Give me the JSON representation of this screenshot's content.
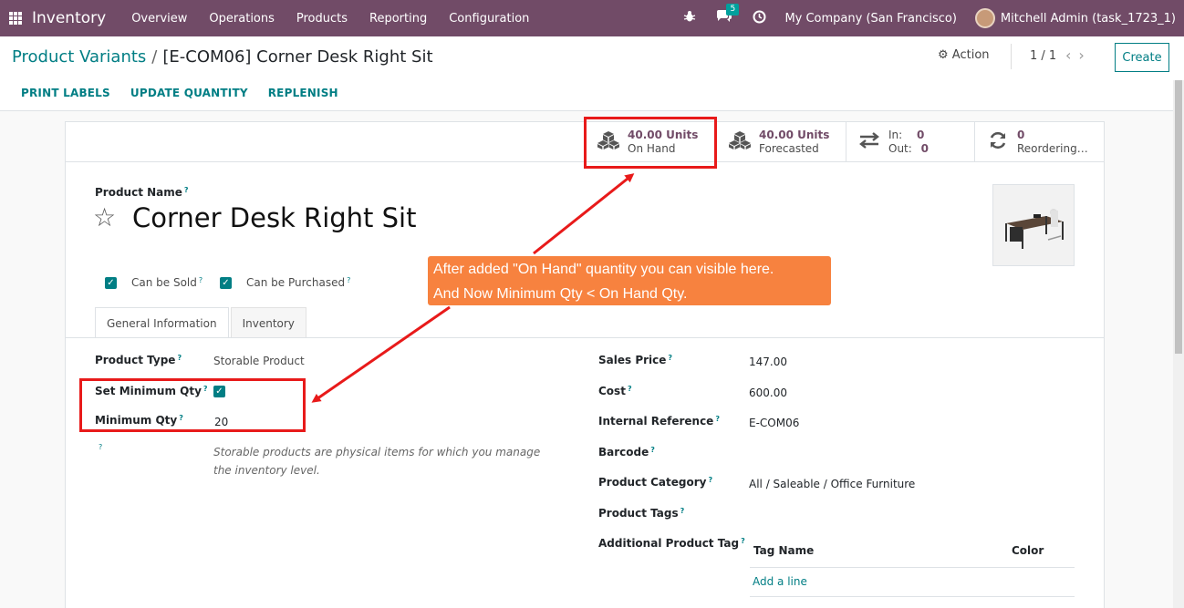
{
  "navbar": {
    "brand": "Inventory",
    "menu": [
      "Overview",
      "Operations",
      "Products",
      "Reporting",
      "Configuration"
    ],
    "chat_badge": "5",
    "company": "My Company (San Francisco)",
    "user": "Mitchell Admin (task_1723_1)"
  },
  "control_panel": {
    "breadcrumb_parent": "Product Variants",
    "breadcrumb_sep": "/",
    "breadcrumb_current": "[E-COM06] Corner Desk Right Sit",
    "action_label": "Action",
    "pager": "1 / 1",
    "create_label": "Create",
    "toolbar": [
      "PRINT LABELS",
      "UPDATE QUANTITY",
      "REPLENISH"
    ]
  },
  "stat_buttons": {
    "on_hand_value": "40.00 Units",
    "on_hand_label": "On Hand",
    "forecast_value": "40.00 Units",
    "forecast_label": "Forecasted",
    "in_label": "In:",
    "in_value": "0",
    "out_label": "Out:",
    "out_value": "0",
    "reorder_value": "0",
    "reorder_label": "Reordering…"
  },
  "form": {
    "product_name_label": "Product Name",
    "product_name": "Corner Desk Right Sit",
    "can_be_sold": "Can be Sold",
    "can_be_purchased": "Can be Purchased",
    "tabs": [
      "General Information",
      "Inventory"
    ],
    "product_type_label": "Product Type",
    "product_type": "Storable Product",
    "set_min_qty_label": "Set Minimum Qty",
    "min_qty_label": "Minimum Qty",
    "min_qty": "20",
    "help_text": "Storable products are physical items for which you manage the inventory level.",
    "sales_price_label": "Sales Price",
    "sales_price": "147.00",
    "cost_label": "Cost",
    "cost": "600.00",
    "internal_ref_label": "Internal Reference",
    "internal_ref": "E-COM06",
    "barcode_label": "Barcode",
    "category_label": "Product Category",
    "category": "All / Saleable / Office Furniture",
    "tags_label": "Product Tags",
    "additional_tag_label": "Additional Product Tag",
    "tag_col_name": "Tag Name",
    "tag_col_color": "Color",
    "add_line": "Add a line",
    "help_mark": "?"
  },
  "annotation": {
    "line1": "After added \"On Hand\" quantity you can visible here.",
    "line2": "And Now Minimum Qty < On Hand Qty."
  },
  "colors": {
    "brand": "#714b67",
    "accent": "#017e84",
    "highlight": "#e81a1a",
    "callout": "#f7823f"
  }
}
